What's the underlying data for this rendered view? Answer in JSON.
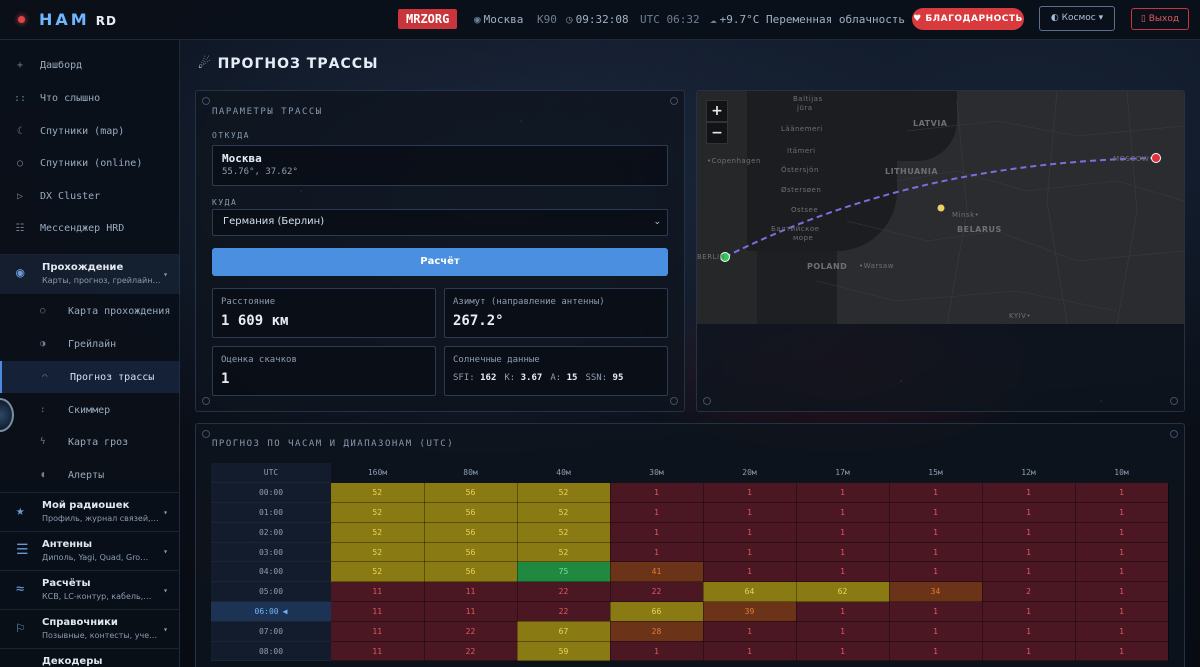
{
  "app": {
    "brand": "HAM",
    "brand_suffix": "RD"
  },
  "topbar": {
    "callsign": "MRZORG",
    "city": "Москва",
    "grid": "K90",
    "local_time": "09:32:08",
    "utc_time": "UTC 06:32",
    "weather": "+9.7°C Переменная облачность",
    "thanks_label": "БЛАГОДАРНОСТЬ",
    "theme_label": "Космос",
    "exit_label": "Выход"
  },
  "sidebar": {
    "items": [
      {
        "icon": "+",
        "label": "Дашборд"
      },
      {
        "icon": "::",
        "label": "Что слышно"
      },
      {
        "icon": "☾",
        "label": "Спутники (map)"
      },
      {
        "icon": "○",
        "label": "Спутники (online)"
      },
      {
        "icon": "▷",
        "label": "DX Cluster"
      },
      {
        "icon": "☷",
        "label": "Мессенджер HRD"
      }
    ],
    "group_propagation": {
      "title": "Прохождение",
      "subtitle": "Карты, прогноз, грейлайн…"
    },
    "sub_items": [
      {
        "icon": "○",
        "label": "Карта прохождения"
      },
      {
        "icon": "◑",
        "label": "Грейлайн"
      },
      {
        "icon": "⌒",
        "label": "Прогноз трассы"
      },
      {
        "icon": ":",
        "label": "Скиммер"
      },
      {
        "icon": "ϟ",
        "label": "Карта гроз"
      },
      {
        "icon": "◖",
        "label": "Алерты"
      }
    ],
    "groups": [
      {
        "icon": "★",
        "title": "Мой радиошек",
        "subtitle": "Профиль, журнал связей,…"
      },
      {
        "icon": "☰",
        "title": "Антенны",
        "subtitle": "Диполь, Yagi, Quad, Gro…"
      },
      {
        "icon": "≈",
        "title": "Расчёты",
        "subtitle": "КСВ, LC-контур, кабель,…"
      },
      {
        "icon": "⚐",
        "title": "Справочники",
        "subtitle": "Позывные, контесты, уче…"
      },
      {
        "icon": "",
        "title": "Декодеры",
        "subtitle": ""
      }
    ]
  },
  "page": {
    "title": "ПРОГНОЗ ТРАССЫ"
  },
  "params": {
    "section": "ПАРАМЕТРЫ ТРАССЫ",
    "from_label": "ОТКУДА",
    "from_name": "Москва",
    "from_coords": "55.76°, 37.62°",
    "to_label": "КУДА",
    "to_value": "Германия (Берлин)",
    "calc_label": "Расчёт",
    "distance_label": "Расстояние",
    "distance_value": "1 609 км",
    "azimuth_label": "Азимут (направление антенны)",
    "azimuth_value": "267.2°",
    "hops_label": "Оценка скачков",
    "hops_value": "1",
    "solar_label": "Солнечные данные",
    "sfi_label": "SFI:",
    "sfi": "162",
    "k_label": "K:",
    "k": "3.67",
    "a_label": "A:",
    "a": "15",
    "ssn_label": "SSN:",
    "ssn": "95"
  },
  "map": {
    "zoom_in": "+",
    "zoom_out": "−",
    "labels": {
      "latvia": "LATVIA",
      "lithuania": "LITHUANIA",
      "belarus": "BELARUS",
      "poland": "POLAND",
      "copenhagen": "•Copenhagen",
      "minsk": "Minsk•",
      "warsaw": "•Warsaw",
      "kyiv": "KYIV•",
      "ostsee": "Ostsee",
      "baltic": "Балтийское",
      "more": "море",
      "berlin": "BERLIN",
      "moscow": "MOSCOW",
      "itameri": "Itämeri",
      "ostersjon": "Östersjön",
      "ostersoen": "Østersøen",
      "laanemeri": "Läänemeri",
      "baltijas": "Baltijas",
      "jura": "jūra"
    },
    "colors": {
      "path": "#7b6fe0",
      "origin": "#e0303a",
      "dest": "#2ecc55",
      "midpoint": "#f0d060"
    }
  },
  "forecast": {
    "section": "ПРОГНОЗ ПО ЧАСАМ И ДИАПАЗОНАМ (UTC)",
    "utc_header": "UTC",
    "bands": [
      "160м",
      "80м",
      "40м",
      "30м",
      "20м",
      "17м",
      "15м",
      "12м",
      "10м"
    ],
    "current_marker": "◀",
    "rows": [
      {
        "utc": "00:00",
        "values": [
          "52",
          "56",
          "52",
          "1",
          "1",
          "1",
          "1",
          "1",
          "1"
        ],
        "levels": [
          "y",
          "y",
          "y",
          "r",
          "r",
          "r",
          "r",
          "r",
          "r"
        ]
      },
      {
        "utc": "01:00",
        "values": [
          "52",
          "56",
          "52",
          "1",
          "1",
          "1",
          "1",
          "1",
          "1"
        ],
        "levels": [
          "y",
          "y",
          "y",
          "r",
          "r",
          "r",
          "r",
          "r",
          "r"
        ]
      },
      {
        "utc": "02:00",
        "values": [
          "52",
          "56",
          "52",
          "1",
          "1",
          "1",
          "1",
          "1",
          "1"
        ],
        "levels": [
          "y",
          "y",
          "y",
          "r",
          "r",
          "r",
          "r",
          "r",
          "r"
        ]
      },
      {
        "utc": "03:00",
        "values": [
          "52",
          "56",
          "52",
          "1",
          "1",
          "1",
          "1",
          "1",
          "1"
        ],
        "levels": [
          "y",
          "y",
          "y",
          "r",
          "r",
          "r",
          "r",
          "r",
          "r"
        ]
      },
      {
        "utc": "04:00",
        "values": [
          "52",
          "56",
          "75",
          "41",
          "1",
          "1",
          "1",
          "1",
          "1"
        ],
        "levels": [
          "y",
          "y",
          "g",
          "o",
          "r",
          "r",
          "r",
          "r",
          "r"
        ]
      },
      {
        "utc": "05:00",
        "values": [
          "11",
          "11",
          "22",
          "22",
          "64",
          "62",
          "34",
          "2",
          "1"
        ],
        "levels": [
          "r",
          "r",
          "r",
          "r",
          "y",
          "y",
          "o",
          "r",
          "r"
        ]
      },
      {
        "utc": "06:00",
        "values": [
          "11",
          "11",
          "22",
          "66",
          "39",
          "1",
          "1",
          "1",
          "1"
        ],
        "levels": [
          "r",
          "r",
          "r",
          "y",
          "o",
          "r",
          "r",
          "r",
          "r"
        ],
        "now": true
      },
      {
        "utc": "07:00",
        "values": [
          "11",
          "22",
          "67",
          "28",
          "1",
          "1",
          "1",
          "1",
          "1"
        ],
        "levels": [
          "r",
          "r",
          "y",
          "o",
          "r",
          "r",
          "r",
          "r",
          "r"
        ]
      },
      {
        "utc": "08:00",
        "values": [
          "11",
          "22",
          "59",
          "1",
          "1",
          "1",
          "1",
          "1",
          "1"
        ],
        "levels": [
          "r",
          "r",
          "y",
          "r",
          "r",
          "r",
          "r",
          "r",
          "r"
        ]
      }
    ]
  }
}
